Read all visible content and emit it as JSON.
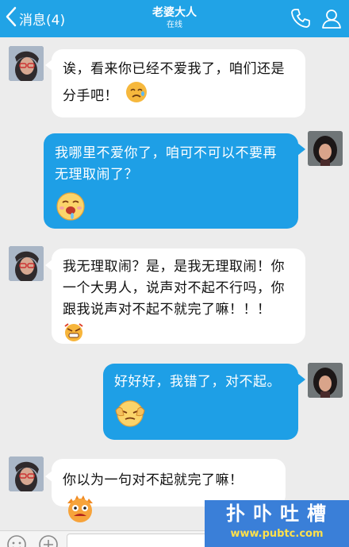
{
  "header": {
    "back_label": "消息(4)",
    "title": "老婆大人",
    "status": "在线",
    "icons": [
      "chevron-left-icon",
      "phone-icon",
      "profile-icon"
    ],
    "bg_color": "#21a3e6"
  },
  "messages": [
    {
      "side": "in",
      "lines": [
        "诶，看来你已经不爱我了，咱们还是",
        "分手吧！"
      ],
      "emoji": "crying-face-emoji"
    },
    {
      "side": "out",
      "lines": [
        "我哪里不爱你了，咱可不可以不要再",
        "无理取闹了？"
      ],
      "emoji": "drooling-face-emoji"
    },
    {
      "side": "in",
      "lines": [
        "我无理取闹？是，是我无理取闹！你",
        "一个大男人，说声对不起不行吗，你",
        "跟我说声对不起不就完了嘛！！！"
      ],
      "emoji": "angry-face-emoji"
    },
    {
      "side": "out",
      "lines": [
        "好好好，我错了，对不起。"
      ],
      "emoji": "cheek-pinch-emoji"
    },
    {
      "side": "in",
      "lines": [
        "你以为一句对不起就完了嘛！"
      ],
      "emoji": "furious-monster-emoji"
    }
  ],
  "colors": {
    "incoming_bubble": "#ffffff",
    "outgoing_bubble": "#1e9fe6",
    "background": "#ececec"
  },
  "input_bar": {
    "icons": [
      "emoji-smiley-icon",
      "plus-icon"
    ]
  },
  "watermark": {
    "title": "扑卟吐槽",
    "url": "www.pubtc.com"
  }
}
